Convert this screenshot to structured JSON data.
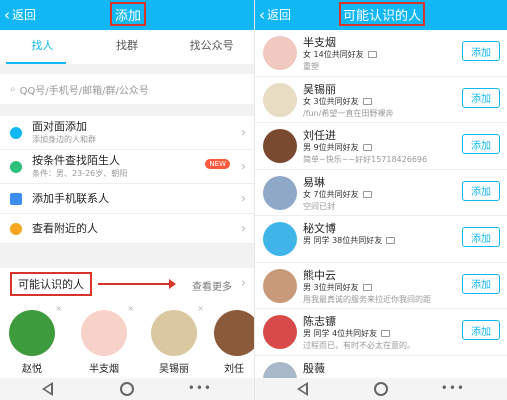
{
  "left": {
    "back": "返回",
    "title": "添加",
    "tabs": [
      "找人",
      "找群",
      "找公众号"
    ],
    "search_placeholder": "QQ号/手机号/邮箱/群/公众号",
    "menu": [
      {
        "title": "面对面添加",
        "sub": "添加身边的人和群",
        "icon": "face-to-face-icon",
        "color": "#12b7f5"
      },
      {
        "title": "按条件查找陌生人",
        "sub": "条件：男、23-26岁、朝阳",
        "icon": "condition-search-icon",
        "color": "#2ec07a",
        "badge": "NEW"
      },
      {
        "title": "添加手机联系人",
        "sub": "",
        "icon": "phone-contacts-icon",
        "color": "#3b8ef0"
      },
      {
        "title": "查看附近的人",
        "sub": "",
        "icon": "nearby-people-icon",
        "color": "#f5a623"
      }
    ],
    "maybe_know": "可能认识的人",
    "see_more": "查看更多",
    "people": [
      {
        "name": "赵悦",
        "color": "#3d9b3d"
      },
      {
        "name": "半支烟",
        "color": "#f7d2c8"
      },
      {
        "name": "吴锡丽",
        "color": "#d9c8a0"
      },
      {
        "name": "刘任",
        "color": "#8a5a3a"
      }
    ]
  },
  "right": {
    "back": "返回",
    "title": "可能认识的人",
    "add_label": "添加",
    "rows": [
      {
        "name": "半支烟",
        "meta": "女 14位共同好友",
        "sig": "重塑",
        "color": "#f2c9c0"
      },
      {
        "name": "吴锡丽",
        "meta": "女 3位共同好友",
        "sig": "/fun/希望一直在田野裸奔",
        "color": "#e8dcc2"
      },
      {
        "name": "刘任进",
        "meta": "男 9位共同好友",
        "sig": "简单~快乐~~好好15718426696",
        "color": "#7a4a30"
      },
      {
        "name": "易琳",
        "meta": "女 7位共同好友",
        "sig": "空间已封",
        "color": "#8fa8c8"
      },
      {
        "name": "秘文博",
        "meta": "男 同学 38位共同好友",
        "sig": "",
        "color": "#3fb4e8"
      },
      {
        "name": "熊中云",
        "meta": "男 3位共同好友",
        "sig": "用我最真诚的服务来拉近你我间的距",
        "color": "#c89a7a"
      },
      {
        "name": "陈志镖",
        "meta": "男 同学 4位共同好友",
        "sig": "过程而已，有时不必太在意的。",
        "color": "#d84a4a"
      },
      {
        "name": "殷薇",
        "meta": "",
        "sig": "",
        "color": "#a8b8c8"
      }
    ]
  }
}
